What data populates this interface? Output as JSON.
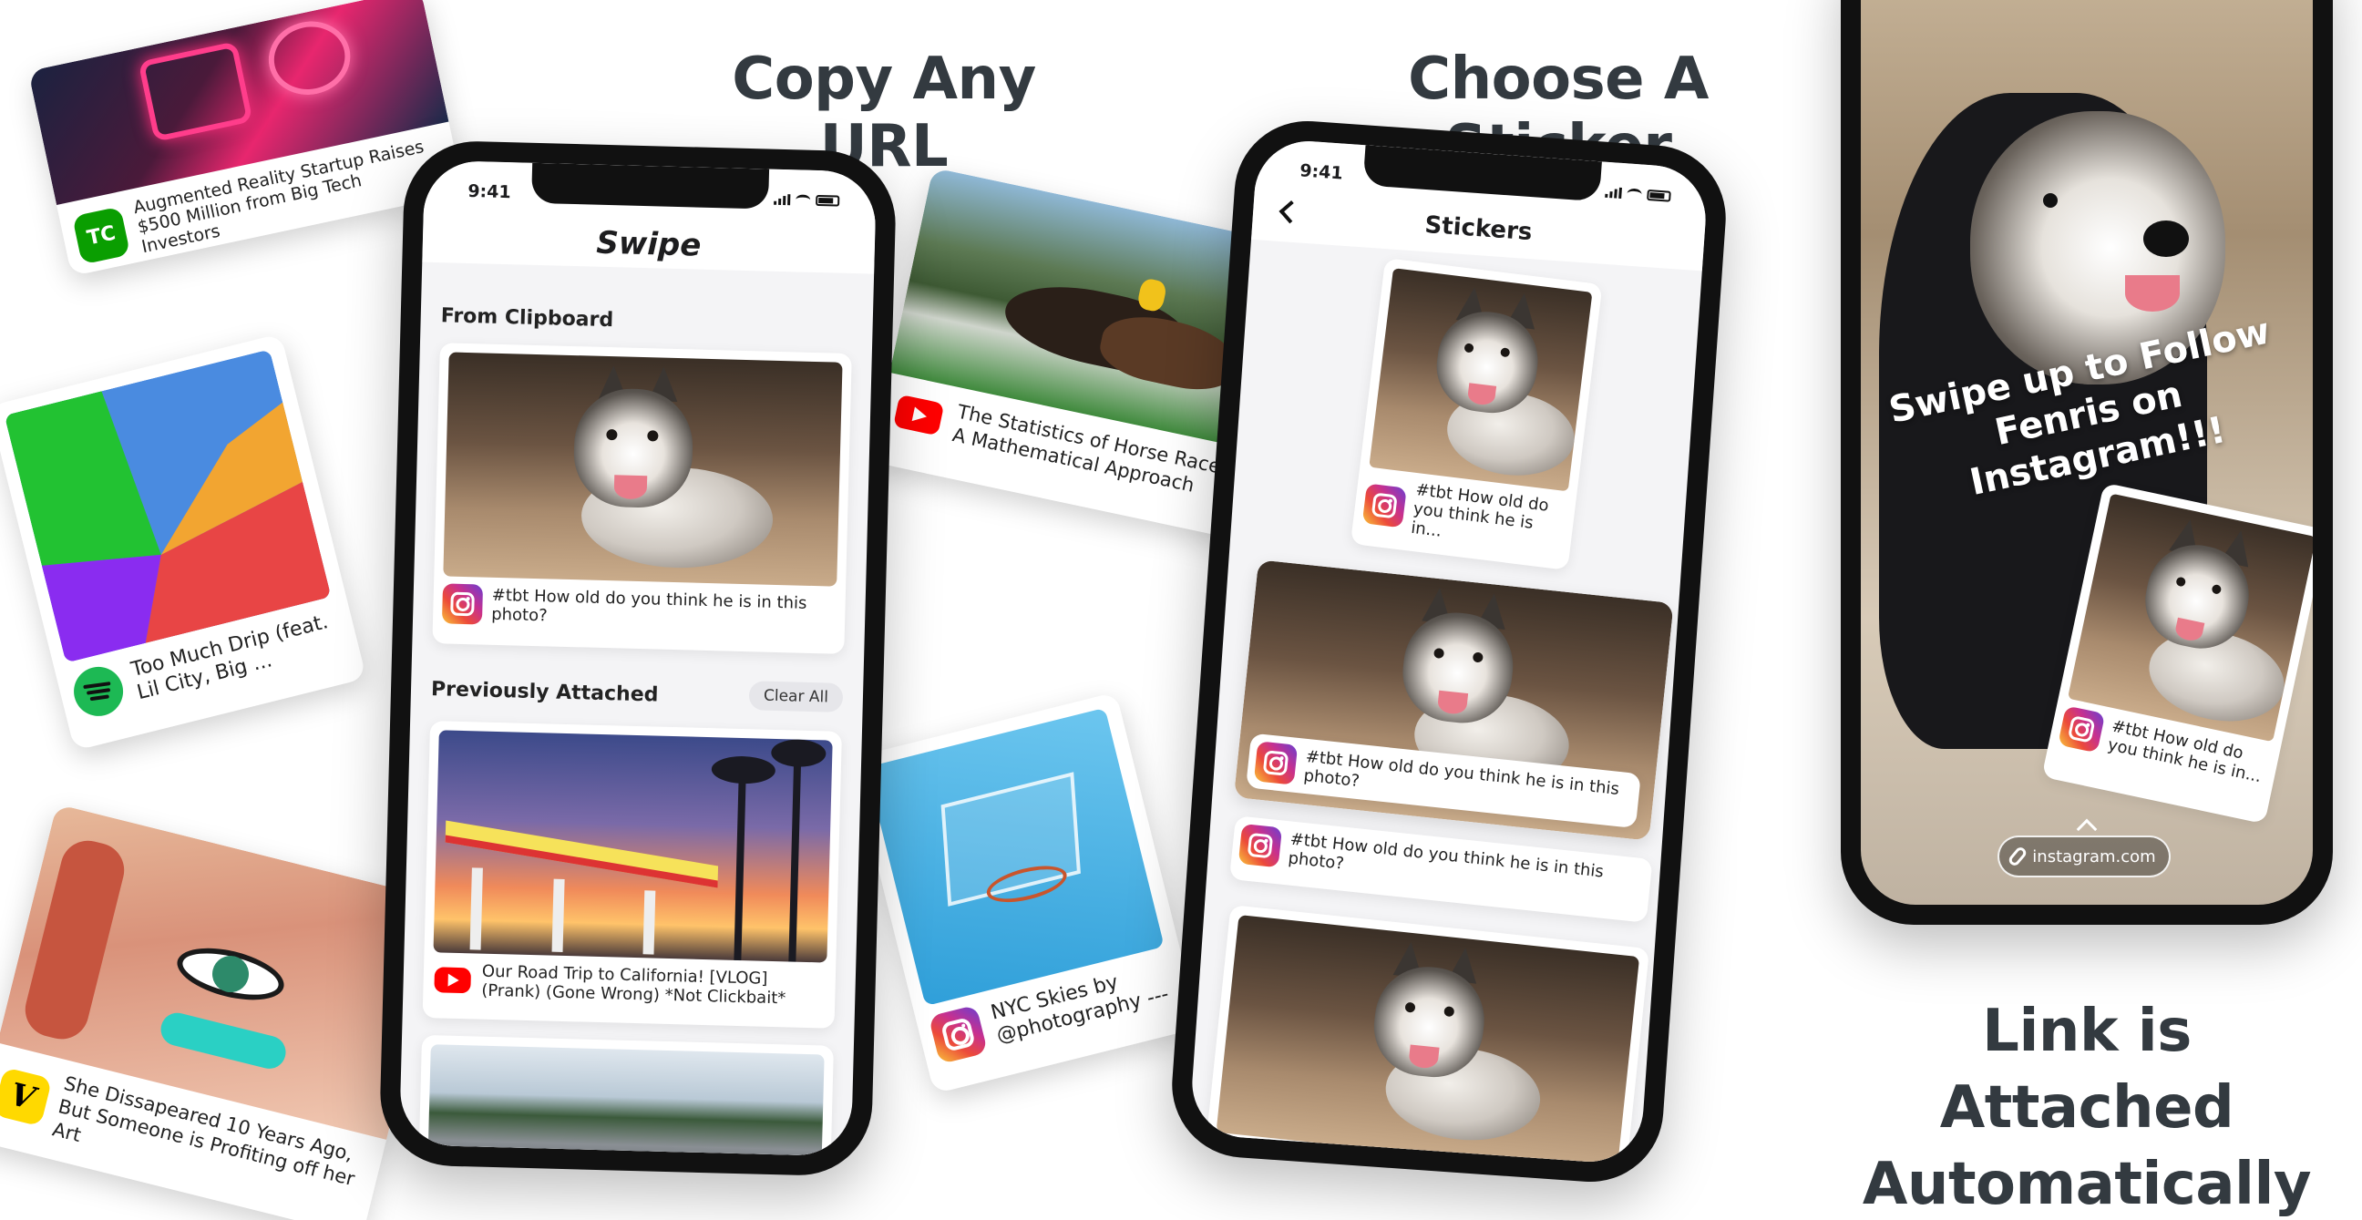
{
  "headlines": {
    "copy_any_url": "Copy Any URL",
    "choose_a_sticker": "Choose A Sticker",
    "link_attached_line1": "Link is Attached",
    "link_attached_line2": "Automatically"
  },
  "floating_cards": {
    "techcrunch": {
      "text": "Augmented Reality Startup Raises $500 Million from Big Tech Investors",
      "icon": "techcrunch-icon",
      "icon_label": "TC"
    },
    "spotify": {
      "text": "Too Much Drip (feat. Lil City, Big ...",
      "icon": "spotify-icon"
    },
    "vice": {
      "text": "She Dissapeared 10 Years Ago, But Someone is Profiting off her Art",
      "icon": "vice-icon",
      "icon_label": "V"
    },
    "horse_races": {
      "text": "The Statistics of Horse Races – A Mathematical Approach",
      "icon": "youtube-icon"
    },
    "nyc_skies": {
      "text": "NYC Skies by @photography ---",
      "icon": "instagram-icon"
    }
  },
  "phone_swipe": {
    "time": "9:41",
    "app_title": "Swipe",
    "from_clipboard_title": "From Clipboard",
    "clipboard_card_text": "#tbt How old do you think he is in this photo?",
    "previously_attached_title": "Previously Attached",
    "clear_all_label": "Clear All",
    "attached_card_1_text": "Our Road Trip to California! [VLOG] (Prank) (Gone Wrong) *Not Clickbait*"
  },
  "phone_stickers": {
    "time": "9:41",
    "title": "Stickers",
    "sticker_polaroid_text": "#tbt How old do you think he is in...",
    "sticker_wide_text": "#tbt How old do you think he is in this photo?",
    "sticker_plain_text": "#tbt How old do you think he is in this photo?"
  },
  "phone_story": {
    "caption": "Swipe up to Follow Fenris on Instagram!!!",
    "sticker_text": "#tbt How old do you think he is in...",
    "link_pill": "instagram.com"
  },
  "colors": {
    "headline": "#333a40",
    "instagram_gradient": [
      "#f9c33b",
      "#ec4a3a",
      "#c7308f",
      "#6a3fd0"
    ],
    "youtube_red": "#ff0000",
    "spotify_green": "#1db954",
    "techcrunch_green": "#0a9e01"
  }
}
